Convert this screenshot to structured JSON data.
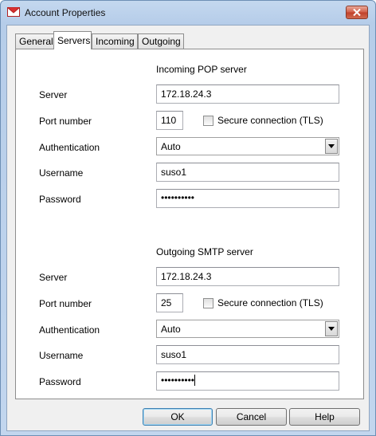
{
  "window": {
    "title": "Account Properties",
    "close_icon": "close-icon"
  },
  "tabs": [
    {
      "label": "General",
      "active": false
    },
    {
      "label": "Servers",
      "active": true
    },
    {
      "label": "Incoming",
      "active": false
    },
    {
      "label": "Outgoing",
      "active": false
    }
  ],
  "incoming": {
    "section_title": "Incoming POP server",
    "server_label": "Server",
    "server_value": "172.18.24.3",
    "port_label": "Port number",
    "port_value": "110",
    "secure_label": "Secure connection (TLS)",
    "secure_checked": false,
    "auth_label": "Authentication",
    "auth_value": "Auto",
    "username_label": "Username",
    "username_value": "suso1",
    "password_label": "Password",
    "password_value": "••••••••••"
  },
  "outgoing": {
    "section_title": "Outgoing SMTP server",
    "server_label": "Server",
    "server_value": "172.18.24.3",
    "port_label": "Port number",
    "port_value": "25",
    "secure_label": "Secure connection (TLS)",
    "secure_checked": false,
    "auth_label": "Authentication",
    "auth_value": "Auto",
    "username_label": "Username",
    "username_value": "suso1",
    "password_label": "Password",
    "password_value": "••••••••••"
  },
  "buttons": {
    "ok": "OK",
    "cancel": "Cancel",
    "help": "Help"
  },
  "colors": {
    "titlebar": "#b6cde9",
    "close_button": "#c0402a",
    "default_button_border": "#3c7fb1"
  }
}
